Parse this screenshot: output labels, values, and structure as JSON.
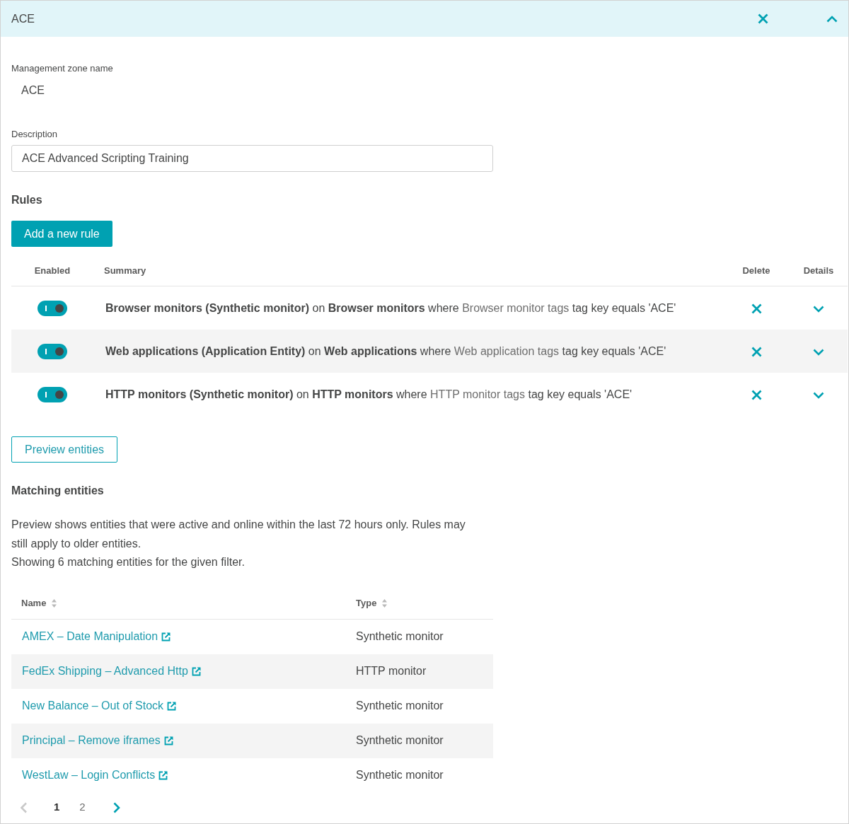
{
  "panel": {
    "title": "ACE",
    "expanded": true
  },
  "form": {
    "name_label": "Management zone name",
    "name_value": "ACE",
    "description_label": "Description",
    "description_value": "ACE Advanced Scripting Training"
  },
  "rules": {
    "heading": "Rules",
    "add_button": "Add a new rule",
    "columns": [
      "Enabled",
      "Summary",
      "Delete",
      "Details"
    ],
    "rows": [
      {
        "enabled": true,
        "expanded": false,
        "summary": [
          {
            "kind": "strong",
            "text": "Browser monitors (Synthetic monitor)"
          },
          {
            "kind": "plain",
            "text": "on"
          },
          {
            "kind": "strong",
            "text": "Browser monitors"
          },
          {
            "kind": "plain",
            "text": "where"
          },
          {
            "kind": "light",
            "text": "Browser monitor tags"
          },
          {
            "kind": "plain",
            "text": "tag key equals 'ACE'"
          }
        ]
      },
      {
        "enabled": true,
        "expanded": false,
        "summary": [
          {
            "kind": "strong",
            "text": "Web applications (Application Entity)"
          },
          {
            "kind": "plain",
            "text": "on"
          },
          {
            "kind": "strong",
            "text": "Web applications"
          },
          {
            "kind": "plain",
            "text": "where"
          },
          {
            "kind": "light",
            "text": "Web application tags"
          },
          {
            "kind": "plain",
            "text": "tag key equals 'ACE'"
          }
        ]
      },
      {
        "enabled": true,
        "expanded": false,
        "summary": [
          {
            "kind": "strong",
            "text": "HTTP monitors (Synthetic monitor)"
          },
          {
            "kind": "plain",
            "text": "on"
          },
          {
            "kind": "strong",
            "text": "HTTP monitors"
          },
          {
            "kind": "plain",
            "text": "where"
          },
          {
            "kind": "light",
            "text": "HTTP monitor tags"
          },
          {
            "kind": "plain",
            "text": "tag key equals 'ACE'"
          }
        ]
      }
    ]
  },
  "preview_button": "Preview entities",
  "matching": {
    "heading": "Matching entities",
    "note": "Preview shows entities that were active and online within the last 72 hours only. Rules may still apply to older entities.",
    "count": "Showing 6 matching entities for the given filter.",
    "columns": [
      "Name",
      "Type"
    ],
    "rows": [
      {
        "name": "AMEX – Date Manipulation",
        "type": "Synthetic monitor"
      },
      {
        "name": "FedEx Shipping – Advanced Http",
        "type": "HTTP monitor"
      },
      {
        "name": "New Balance – Out of Stock",
        "type": "Synthetic monitor"
      },
      {
        "name": "Principal – Remove iframes",
        "type": "Synthetic monitor"
      },
      {
        "name": "WestLaw – Login Conflicts",
        "type": "Synthetic monitor"
      }
    ]
  },
  "pagination": {
    "prev": {
      "disabled": true
    },
    "pages": [
      {
        "label": "1",
        "selected": true
      },
      {
        "label": "2",
        "selected": false
      }
    ],
    "next": {
      "disabled": false
    }
  }
}
